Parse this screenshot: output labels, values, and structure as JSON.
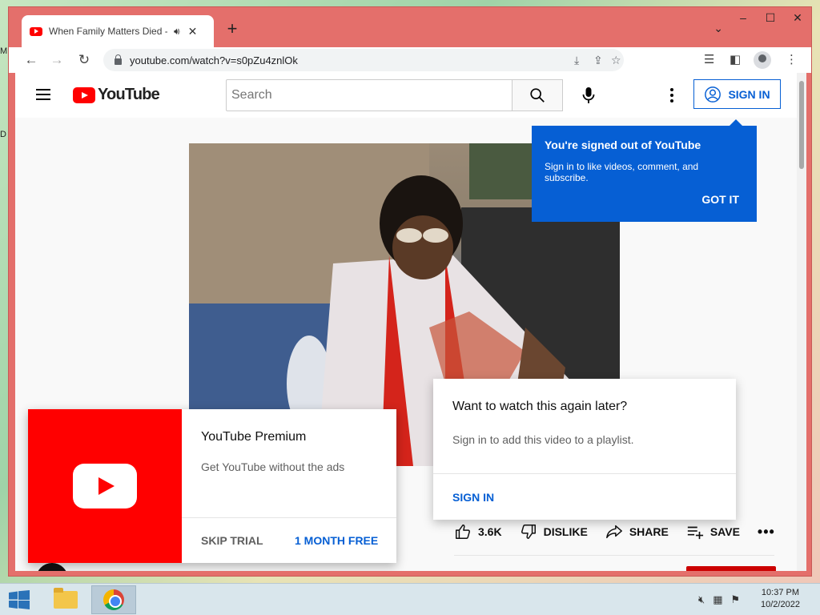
{
  "desktop": {
    "edge_labels": [
      "M",
      "D"
    ]
  },
  "browser": {
    "tab": {
      "title": "When Family Matters Died -",
      "audio_icon": "speaker-icon",
      "close": "✕"
    },
    "new_tab": "+",
    "window_controls": {
      "minimize": "–",
      "maximize": "☐",
      "close": "✕",
      "tab_search": "⌄"
    },
    "nav": {
      "back": "←",
      "forward": "→",
      "reload": "↻"
    },
    "url": "youtube.com/watch?v=s0pZu4znlOk"
  },
  "youtube": {
    "logo_text": "YouTube",
    "search": {
      "placeholder": "Search"
    },
    "signin_label": "SIGN IN",
    "tooltip": {
      "title": "You're signed out of YouTube",
      "body": "Sign in to like videos, comment, and subscribe.",
      "action": "GOT IT"
    },
    "premium": {
      "title": "YouTube Premium",
      "subtitle": "Get YouTube without the ads",
      "skip": "SKIP TRIAL",
      "free": "1 MONTH FREE"
    },
    "watch_later": {
      "title": "Want to watch this again later?",
      "body": "Sign in to add this video to a playlist.",
      "action": "SIGN IN"
    },
    "actions": {
      "likes": "3.6K",
      "dislike": "DISLIKE",
      "share": "SHARE",
      "save": "SAVE",
      "more": "•••"
    }
  },
  "taskbar": {
    "tray_icons": [
      "speaker-muted-icon",
      "network-icon",
      "flag-icon"
    ],
    "time": "10:37 PM",
    "date": "10/2/2022"
  },
  "colors": {
    "accent": "#065fd4",
    "brand_red": "#ff0000",
    "window_frame": "#e46f6b"
  }
}
